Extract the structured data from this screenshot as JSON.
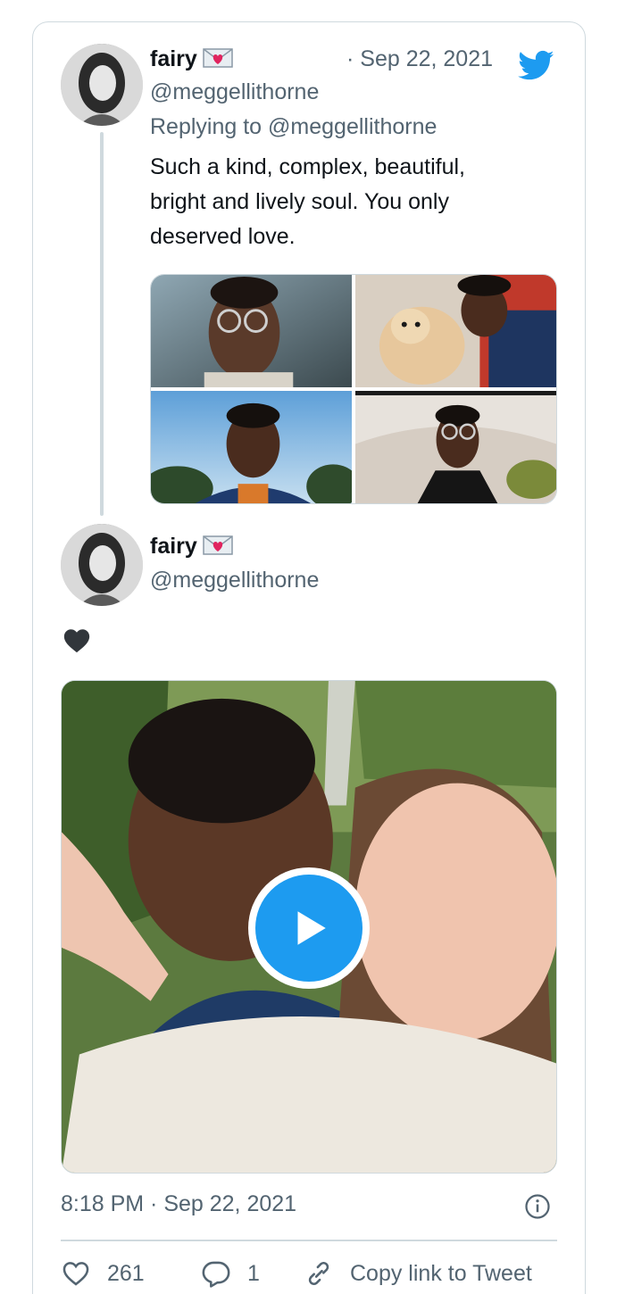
{
  "tweet1": {
    "name": "fairy",
    "handle": "@meggellithorne",
    "date": "· Sep 22, 2021",
    "replying_prefix": "Replying to",
    "replying_handle": "@meggellithorne",
    "text": "Such a kind, complex, beautiful, bright and lively soul. You only deserved love.",
    "media_count": 4
  },
  "tweet2": {
    "name": "fairy",
    "handle": "@meggellithorne",
    "emoji_text": "heart-icon",
    "timestamp": "8:18 PM · Sep 22, 2021"
  },
  "actions": {
    "likes": "261",
    "replies": "1",
    "copy_link_label": "Copy link to Tweet"
  },
  "icons": {
    "brand": "twitter-bird-icon",
    "name_emoji": "envelope-heart-icon",
    "info": "info-icon",
    "like": "heart-outline-icon",
    "reply": "reply-bubble-icon",
    "link": "link-icon",
    "play": "play-icon"
  },
  "colors": {
    "brand_blue": "#1d9bf0",
    "text_primary": "#0f1419",
    "text_secondary": "#536471",
    "border": "#cfd9de"
  }
}
